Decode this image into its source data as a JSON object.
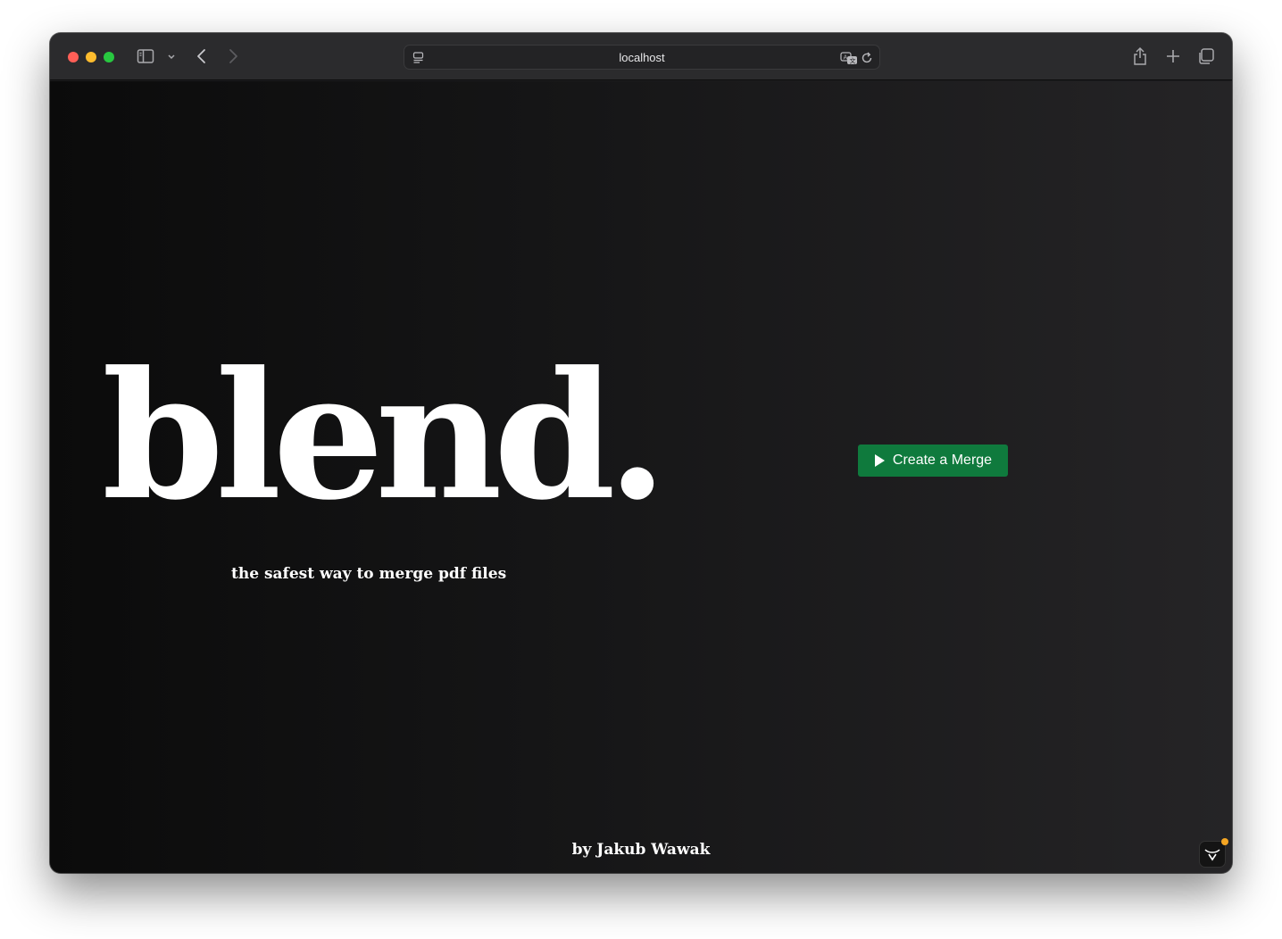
{
  "browser": {
    "url": "localhost",
    "icons": [
      "sidebar-icon",
      "chevron-down-icon",
      "back-icon",
      "forward-icon",
      "site-icon",
      "translate-icon",
      "reload-icon",
      "share-icon",
      "new-tab-icon",
      "tabs-overview-icon"
    ]
  },
  "page": {
    "brand": "blend.",
    "tagline": "the safest way to merge pdf files",
    "cta_label": "Create a Merge",
    "byline": "by Jakub Wawak"
  },
  "colors": {
    "cta_background": "#0f7a3d",
    "page_background_left": "#0b0b0b",
    "page_background_right": "#252426",
    "text": "#ffffff"
  }
}
